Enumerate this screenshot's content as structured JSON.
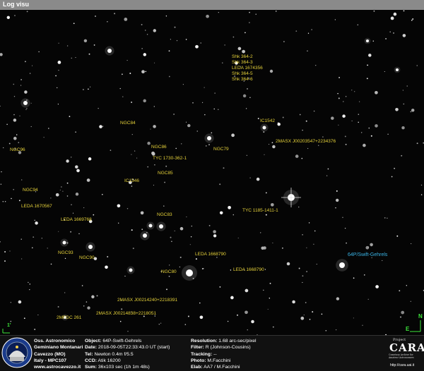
{
  "window": {
    "title": "Log visu"
  },
  "labels": [
    {
      "text": "Shk 364-2"
    },
    {
      "text": "Shk 364-3"
    },
    {
      "text": "LEDA 1674356"
    },
    {
      "text": "Shk 364-5"
    },
    {
      "text": "Shk 364-6"
    },
    {
      "text": "IC1542"
    },
    {
      "text": "NGC84"
    },
    {
      "text": "NGC86"
    },
    {
      "text": "NGC79"
    },
    {
      "text": "2MASX J00203547+2234376"
    },
    {
      "text": "TYC 1730-362-1"
    },
    {
      "text": "NGC96"
    },
    {
      "text": "NGC85"
    },
    {
      "text": "IC1546"
    },
    {
      "text": "NGC94"
    },
    {
      "text": "LEDA 1670567"
    },
    {
      "text": "TYC 1185-1411-1"
    },
    {
      "text": "NGC83"
    },
    {
      "text": "LEDA 1669768"
    },
    {
      "text": "NGC93"
    },
    {
      "text": "NGC90"
    },
    {
      "text": "LEDA 1668790"
    },
    {
      "text": "LEDA 1668790"
    },
    {
      "text": "NGC80"
    },
    {
      "text": "2MASX J00214240+2218391"
    },
    {
      "text": "2MASX J00214838+2218051"
    },
    {
      "text": "2MFGC 261"
    }
  ],
  "target_label": "64P/Swift-Gehrels",
  "compass": {
    "north": "N",
    "east": "E"
  },
  "scale_marker": "1'",
  "footer": {
    "observatory": [
      "Oss. Astronomico",
      "Geminiano Montanari",
      "Cavezzo (MO)",
      "Italy - MPC107",
      "www.astrocavezzo.it"
    ],
    "object": {
      "label": "Object:",
      "value": "64P-Swift-Gehrels"
    },
    "date": {
      "label": "Date:",
      "value": "2018-09-05T22:33:43.0 UT (start)"
    },
    "tel": {
      "label": "Tel:",
      "value": "Newton 0.4m f/5.5"
    },
    "ccd": {
      "label": "CCD:",
      "value": "Atik 16200"
    },
    "sum": {
      "label": "Sum:",
      "value": "36x103 sec (1h 1m 48s)"
    },
    "resolution": {
      "label": "Resolution:",
      "value": "1.68 arc-sec/pixel"
    },
    "filter": {
      "label": "Filter:",
      "value": "R (Johnson-Cousins)"
    },
    "tracking": {
      "label": "Tracking:",
      "value": "--"
    },
    "photo": {
      "label": "Photo:",
      "value": "M.Facchini"
    },
    "elab": {
      "label": "Elab:",
      "value": "AA7 / M.Facchini"
    },
    "cara": {
      "project": "Project",
      "name": "CARA",
      "subtitle": "Cometary Archive for Amateur Astronomers",
      "url": "http://cara.uai.it"
    }
  }
}
